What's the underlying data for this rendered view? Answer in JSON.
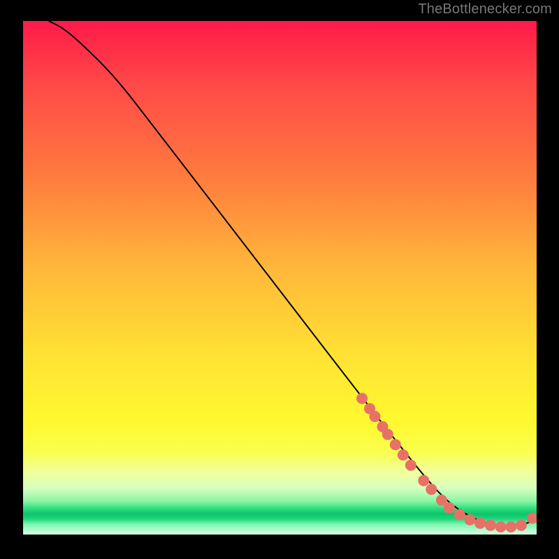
{
  "attribution": "TheBottlenecker.com",
  "chart_data": {
    "type": "line",
    "title": "",
    "xlabel": "",
    "ylabel": "",
    "xlim": [
      0,
      100
    ],
    "ylim": [
      0,
      100
    ],
    "series": [
      {
        "name": "curve",
        "x": [
          5,
          8,
          12,
          18,
          25,
          35,
          45,
          55,
          65,
          72,
          78,
          82,
          86,
          90,
          94,
          97,
          100
        ],
        "y": [
          100,
          98.5,
          95,
          89,
          80,
          67,
          54,
          41,
          28,
          19,
          11.5,
          7,
          4,
          2.2,
          1.4,
          1.6,
          3.2
        ]
      }
    ],
    "markers": {
      "name": "highlighted-points",
      "color": "#e77167",
      "x": [
        66,
        67.5,
        68.5,
        70,
        71,
        72.5,
        74,
        75.5,
        78,
        79.5,
        81.5,
        83,
        85,
        87,
        89,
        91,
        93,
        95,
        97,
        99.2
      ],
      "y": [
        26.5,
        24.5,
        23,
        21,
        19.5,
        17.5,
        15.5,
        13.5,
        10.5,
        8.8,
        6.7,
        5.2,
        3.9,
        2.9,
        2.2,
        1.8,
        1.5,
        1.5,
        1.8,
        3.2
      ]
    }
  }
}
